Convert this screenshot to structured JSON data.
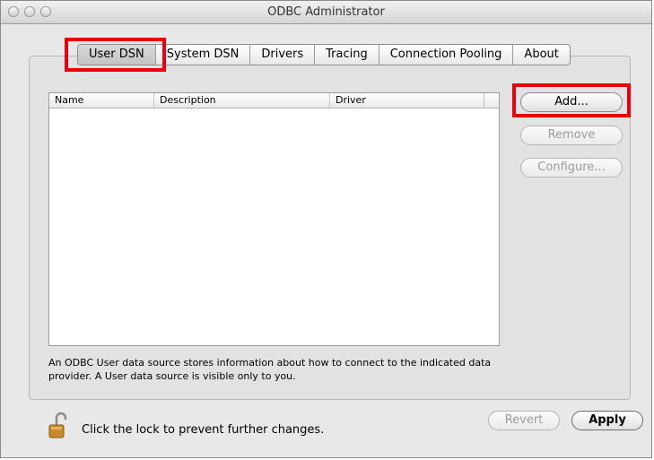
{
  "window": {
    "title": "ODBC Administrator"
  },
  "tabs": [
    {
      "label": "User DSN",
      "active": true
    },
    {
      "label": "System DSN",
      "active": false
    },
    {
      "label": "Drivers",
      "active": false
    },
    {
      "label": "Tracing",
      "active": false
    },
    {
      "label": "Connection Pooling",
      "active": false
    },
    {
      "label": "About",
      "active": false
    }
  ],
  "table": {
    "columns": [
      "Name",
      "Description",
      "Driver"
    ]
  },
  "buttons": {
    "add": "Add...",
    "remove": "Remove",
    "configure": "Configure...",
    "revert": "Revert",
    "apply": "Apply"
  },
  "description": "An ODBC User data source stores information about how to connect to the indicated data provider. A User data source is visible only to you.",
  "lock": {
    "text": "Click the lock to prevent further changes."
  },
  "colors": {
    "highlight": "#e8000d"
  }
}
